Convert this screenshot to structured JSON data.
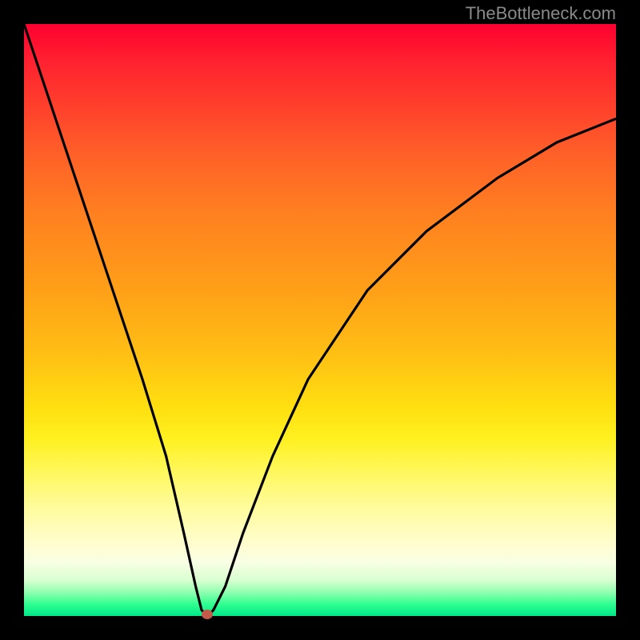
{
  "watermark": "TheBottleneck.com",
  "colors": {
    "background": "#000000",
    "curve_stroke": "#000000",
    "marker_fill": "#c65a4a",
    "watermark_text": "#8a8a8a"
  },
  "chart_data": {
    "type": "line",
    "title": "",
    "xlabel": "",
    "ylabel": "",
    "xlim": [
      0,
      100
    ],
    "ylim": [
      0,
      100
    ],
    "grid": false,
    "legend": false,
    "series": [
      {
        "name": "bottleneck-curve",
        "x": [
          0,
          4,
          8,
          12,
          16,
          20,
          24,
          27,
          29,
          30,
          31,
          32,
          34,
          37,
          42,
          48,
          58,
          68,
          80,
          90,
          100
        ],
        "values": [
          100,
          88,
          76,
          64,
          52,
          40,
          27,
          14,
          5,
          1,
          0,
          1,
          5,
          14,
          27,
          40,
          55,
          65,
          74,
          80,
          84
        ]
      }
    ],
    "annotations": [
      {
        "name": "minimum-marker",
        "x": 31,
        "y": 0
      }
    ]
  }
}
